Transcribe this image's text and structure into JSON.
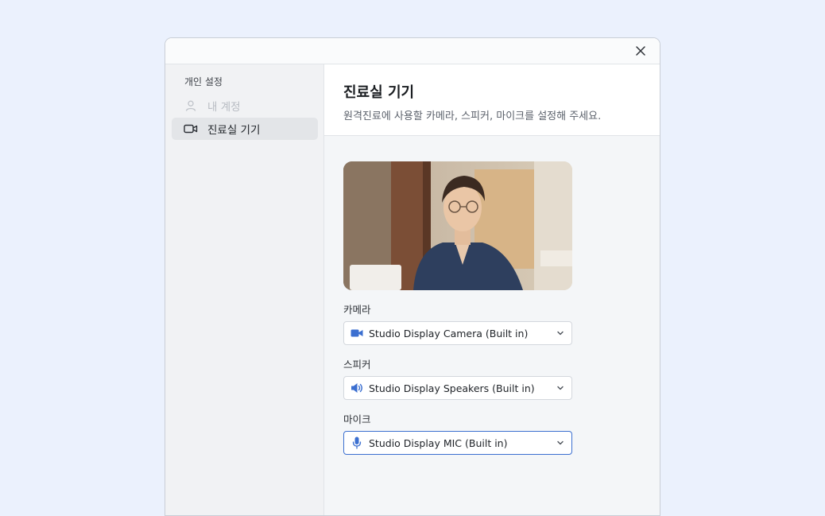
{
  "sidebar": {
    "section_title": "개인 설정",
    "items": [
      {
        "label": "내 계정",
        "icon": "user-icon",
        "state": "disabled"
      },
      {
        "label": "진료실 기기",
        "icon": "video-camera-icon",
        "state": "active"
      }
    ]
  },
  "header": {
    "title": "진료실 기기",
    "description": "원격진료에 사용할 카메라, 스피커, 마이크를 설정해 주세요."
  },
  "devices": {
    "camera": {
      "label": "카메라",
      "value": "Studio Display Camera (Built in)",
      "icon": "video-camera-icon"
    },
    "speaker": {
      "label": "스피커",
      "value": "Studio Display Speakers (Built in)",
      "icon": "speaker-icon"
    },
    "mic": {
      "label": "마이크",
      "value": "Studio Display MIC (Built in)",
      "icon": "microphone-icon"
    }
  },
  "colors": {
    "accent": "#3b6fd0",
    "background": "#ebf1fd"
  }
}
